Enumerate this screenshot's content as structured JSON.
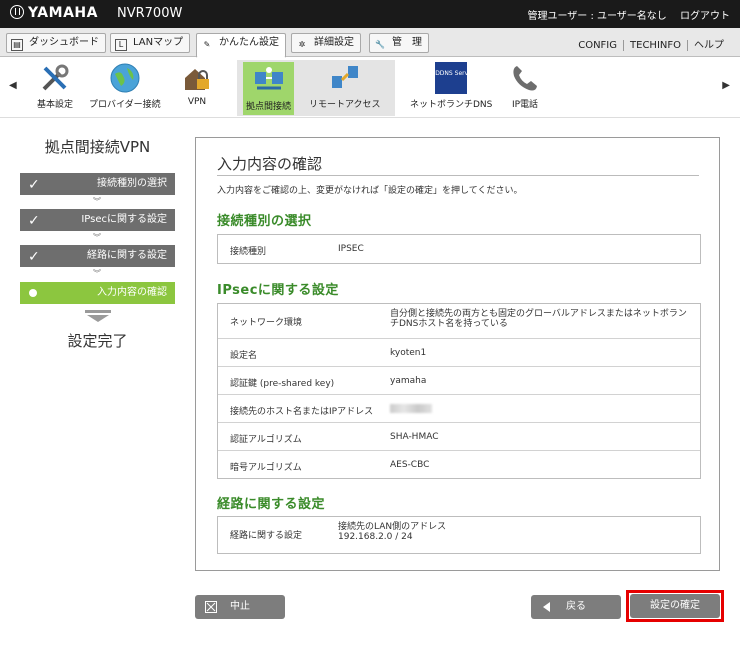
{
  "header": {
    "brand": "YAMAHA",
    "model": "NVR700W",
    "user_label": "管理ユーザー : ユーザー名なし",
    "logout": "ログアウト"
  },
  "menu": {
    "items": [
      {
        "label": "ダッシュボード",
        "icon": "dashboard-icon"
      },
      {
        "label": "LANマップ",
        "icon": "lan-map-icon"
      },
      {
        "label": "かんたん設定",
        "icon": "wand-icon"
      },
      {
        "label": "詳細設定",
        "icon": "gear-icon"
      },
      {
        "label": "管　理",
        "icon": "wrench-icon"
      }
    ],
    "links": [
      "CONFIG",
      "TECHINFO",
      "ヘルプ"
    ]
  },
  "iconnav": {
    "items": [
      {
        "label": "基本設定",
        "icon": "tools-icon"
      },
      {
        "label": "プロバイダー接続",
        "icon": "globe-icon"
      },
      {
        "label": "VPN",
        "icon": "lock-house-icon"
      },
      {
        "label": "拠点間接続",
        "icon": "site-to-site-icon"
      },
      {
        "label": "リモートアクセス",
        "icon": "remote-access-icon"
      },
      {
        "label": "ネットボランチDNS",
        "icon": "ddns-icon"
      },
      {
        "label": "IP電話",
        "icon": "phone-icon"
      }
    ],
    "ddns_badge": "DDNS Service"
  },
  "steps": {
    "title": "拠点間接続VPN",
    "items": [
      {
        "label": "接続種別の選択",
        "status": "done"
      },
      {
        "label": "IPsecに関する設定",
        "status": "done"
      },
      {
        "label": "経路に関する設定",
        "status": "done"
      },
      {
        "label": "入力内容の確認",
        "status": "current"
      }
    ],
    "final": "設定完了"
  },
  "panel": {
    "title": "入力内容の確認",
    "description": "入力内容をご確認の上、変更がなければ「設定の確定」を押してください。",
    "sections": [
      {
        "title": "接続種別の選択",
        "rows": [
          {
            "key": "接続種別",
            "value": "IPSEC"
          }
        ]
      },
      {
        "title": "IPsecに関する設定",
        "rows": [
          {
            "key": "ネットワーク環境",
            "value": "自分側と接続先の両方とも固定のグローバルアドレスまたはネットボランチDNSホスト名を持っている"
          },
          {
            "key": "設定名",
            "value": "kyoten1"
          },
          {
            "key": "認証鍵 (pre-shared key)",
            "value": "yamaha"
          },
          {
            "key": "接続先のホスト名またはIPアドレス",
            "value": ""
          },
          {
            "key": "認証アルゴリズム",
            "value": "SHA-HMAC"
          },
          {
            "key": "暗号アルゴリズム",
            "value": "AES-CBC"
          }
        ]
      },
      {
        "title": "経路に関する設定",
        "rows": [
          {
            "key": "経路に関する設定",
            "value": "接続先のLAN側のアドレス",
            "value2": "192.168.2.0 / 24"
          }
        ]
      }
    ]
  },
  "buttons": {
    "cancel": "中止",
    "back": "戻る",
    "confirm": "設定の確定"
  },
  "colors": {
    "section_title": "#3a8b2a",
    "current_step": "#8cc63f",
    "highlight_border": "#e60000",
    "button_gray": "#7d7d7d"
  }
}
